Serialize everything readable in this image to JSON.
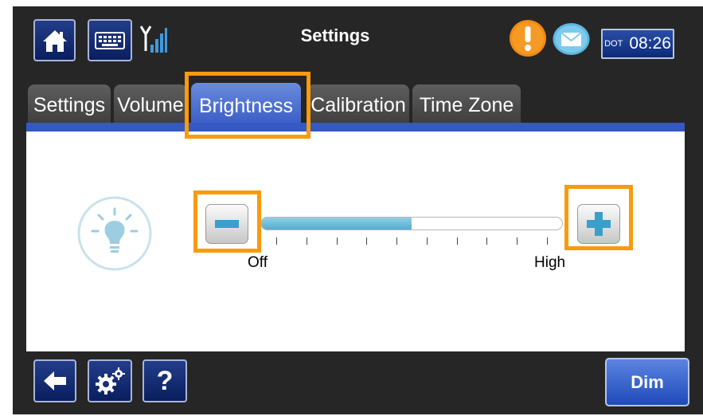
{
  "header": {
    "title": "Settings",
    "clock": {
      "timezone": "DOT",
      "time": "08:26"
    }
  },
  "tabs": [
    {
      "label": "Settings",
      "active": false
    },
    {
      "label": "Volume",
      "active": false
    },
    {
      "label": "Brightness",
      "active": true
    },
    {
      "label": "Calibration",
      "active": false
    },
    {
      "label": "Time Zone",
      "active": false
    }
  ],
  "brightness": {
    "level_fraction": 0.5,
    "tick_count": 10,
    "min_label": "Off",
    "max_label": "High"
  },
  "footer": {
    "help_label": "?",
    "dim_label": "Dim"
  },
  "icons": {
    "home": "home-icon",
    "keyboard": "keyboard-icon",
    "signal": "signal-icon",
    "alert": "alert-icon",
    "mail": "mail-icon",
    "bulb": "bulb-icon",
    "back": "back-arrow-icon",
    "gear": "gear-icon"
  },
  "colors": {
    "highlight": "#f99b0d",
    "tab_active": "#3558c4",
    "slider_fill": "#52aed0",
    "alert": "#f28a12"
  }
}
